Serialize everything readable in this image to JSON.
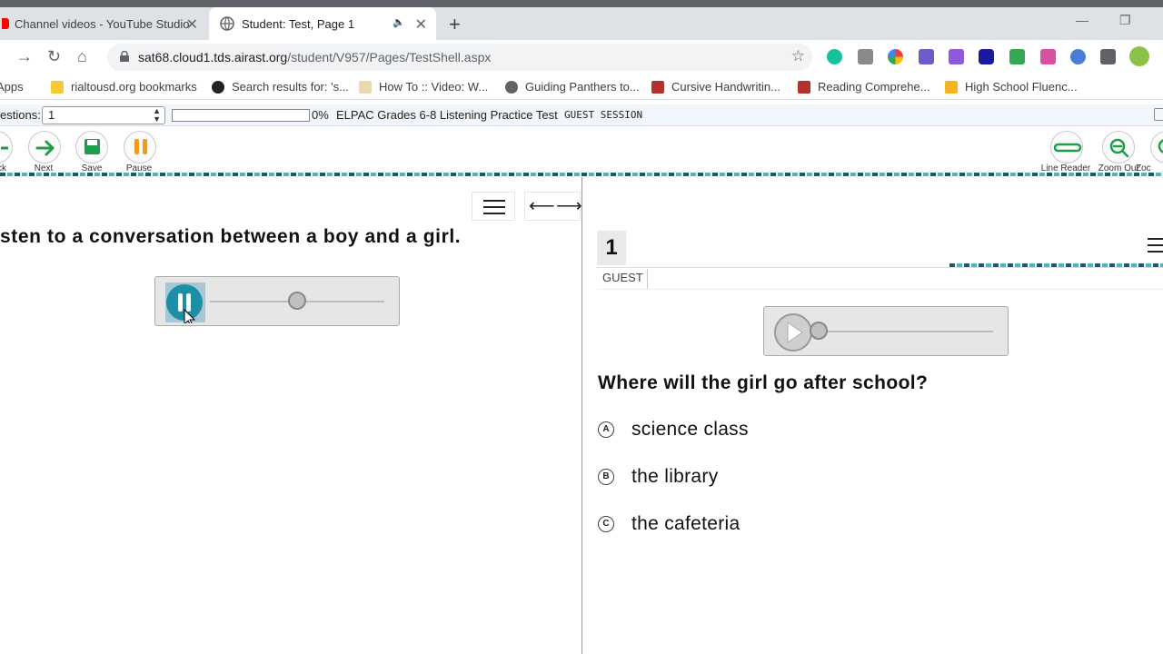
{
  "browser": {
    "tabs": [
      {
        "title": "Channel videos - YouTube Studio",
        "active": false
      },
      {
        "title": "Student: Test, Page 1",
        "active": true
      }
    ],
    "url_host": "sat68.cloud1.tds.airast.org",
    "url_path": "/student/V957/Pages/TestShell.aspx",
    "bookmarks": [
      "Apps",
      "rialtousd.org bookmarks",
      "Search results for: 's...",
      "How To :: Video: W...",
      "Guiding Panthers to...",
      "Cursive Handwritin...",
      "Reading Comprehe...",
      "High School Fluenc..."
    ]
  },
  "testbar": {
    "questions_label": "estions:",
    "question_value": "1",
    "progress_percent": 0,
    "progress_text": "0%",
    "test_name": "ELPAC Grades 6-8 Listening Practice Test",
    "session": "GUEST SESSION"
  },
  "toolbar": {
    "back_label": "ck",
    "next_label": "Next",
    "save_label": "Save",
    "pause_label": "Pause",
    "line_reader_label": "Line Reader",
    "zoom_out_label": "Zoom Out",
    "zoom_in_label": "Zoc"
  },
  "stimulus": {
    "prompt": "sten to a conversation between a boy and a girl.",
    "audio_progress": 0.5
  },
  "item": {
    "number": "1",
    "user_label": "GUEST",
    "audio_progress": 0,
    "question": "Where will the girl go after school?",
    "options": [
      {
        "letter": "A",
        "text": "science class"
      },
      {
        "letter": "B",
        "text": "the library"
      },
      {
        "letter": "C",
        "text": "the cafeteria"
      }
    ]
  },
  "colors": {
    "next_green": "#1e9e4a",
    "save_green": "#1e9e4a",
    "pause_orange": "#f39c12",
    "player_teal": "#1b8fa6"
  }
}
